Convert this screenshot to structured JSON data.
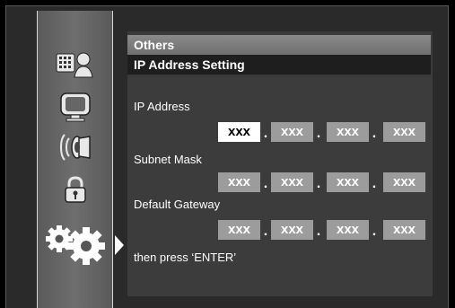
{
  "menu": {
    "title": "Others",
    "subtitle": "IP Address Setting"
  },
  "sidebar": {
    "items": [
      {
        "icon": "keypad-person-icon"
      },
      {
        "icon": "display-icon"
      },
      {
        "icon": "speaker-icon"
      },
      {
        "icon": "lock-icon"
      },
      {
        "icon": "gears-icon",
        "selected": true
      }
    ]
  },
  "fields": {
    "ip_address": {
      "label": "IP Address",
      "octets": [
        "xxx",
        "xxx",
        "xxx",
        "xxx"
      ],
      "separator": "."
    },
    "subnet_mask": {
      "label": "Subnet Mask",
      "octets": [
        "xxx",
        "xxx",
        "xxx",
        "xxx"
      ],
      "separator": "."
    },
    "default_gateway": {
      "label": "Default Gateway",
      "octets": [
        "xxx",
        "xxx",
        "xxx",
        "xxx"
      ],
      "separator": "."
    }
  },
  "instruction": "then press ‘ENTER’"
}
